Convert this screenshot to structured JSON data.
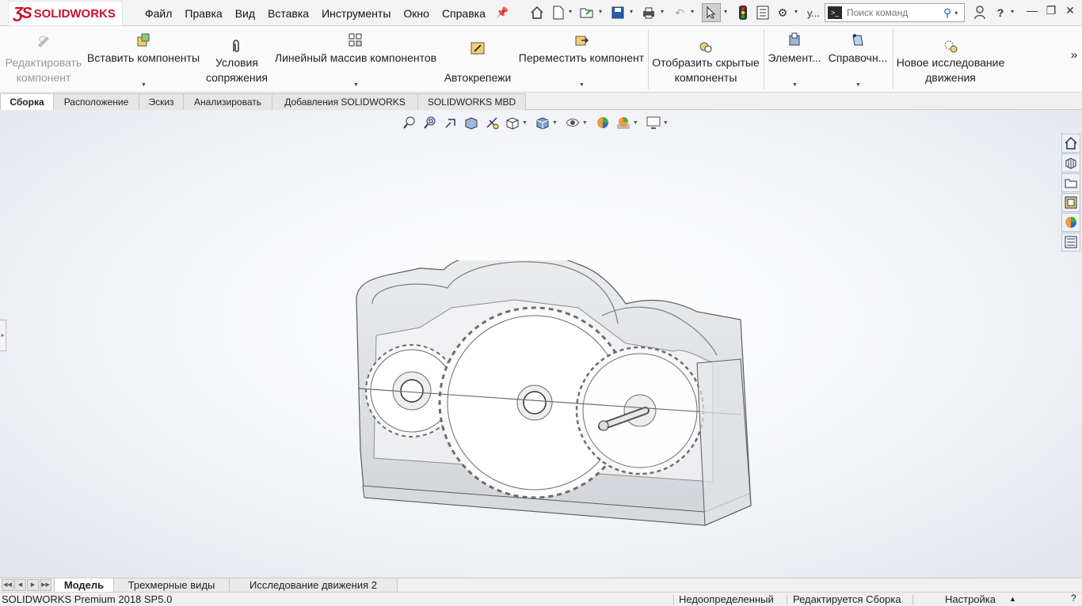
{
  "app": {
    "brand": "SOLIDWORKS"
  },
  "menu": [
    "Файл",
    "Правка",
    "Вид",
    "Вставка",
    "Инструменты",
    "Окно",
    "Справка"
  ],
  "toolbar": {
    "truncated_label": "у...",
    "search_placeholder": "Поиск команд",
    "help_label": "?"
  },
  "ribbon": {
    "edit_component": [
      "Редактировать",
      "компонент"
    ],
    "insert_components": "Вставить компоненты",
    "mates": [
      "Условия",
      "сопряжения"
    ],
    "linear_pattern": "Линейный массив компонентов",
    "smart_fasteners": "Автокрепежи",
    "move_component": "Переместить компонент",
    "show_hidden": [
      "Отобразить скрытые",
      "компоненты"
    ],
    "assembly_features": "Элемент...",
    "reference_geometry": "Справочн...",
    "new_motion_study": [
      "Новое исследование",
      "движения"
    ],
    "more": "»"
  },
  "tabs": [
    {
      "label": "Сборка",
      "active": true
    },
    {
      "label": "Расположение",
      "active": false
    },
    {
      "label": "Эскиз",
      "active": false
    },
    {
      "label": "Анализировать",
      "active": false
    },
    {
      "label": "Добавления SOLIDWORKS",
      "active": false
    },
    {
      "label": "SOLIDWORKS MBD",
      "active": false
    }
  ],
  "bottom_tabs": [
    {
      "label": "Модель",
      "active": true
    },
    {
      "label": "Трехмерные виды",
      "active": false
    },
    {
      "label": "Исследование движения 2",
      "active": false
    }
  ],
  "status": {
    "product": "SOLIDWORKS Premium 2018 SP5.0",
    "definition": "Недоопределенный",
    "mode": "Редактируется Сборка",
    "customize": "Настройка"
  },
  "icons": {
    "hud": [
      "zoom-to-fit-icon",
      "zoom-to-area-icon",
      "previous-view-icon",
      "section-view-icon",
      "dynamic-annotation-icon",
      "view-orientation-icon",
      "display-style-icon",
      "hide-show-items-icon",
      "edit-appearance-icon",
      "apply-scene-icon",
      "view-settings-icon"
    ],
    "taskpane": [
      "home-icon",
      "design-library-icon",
      "file-explorer-icon",
      "view-palette-icon",
      "appearances-icon",
      "custom-properties-icon"
    ]
  },
  "colors": {
    "brand_red": "#c8102e",
    "accent_blue": "#1f6fc4"
  }
}
